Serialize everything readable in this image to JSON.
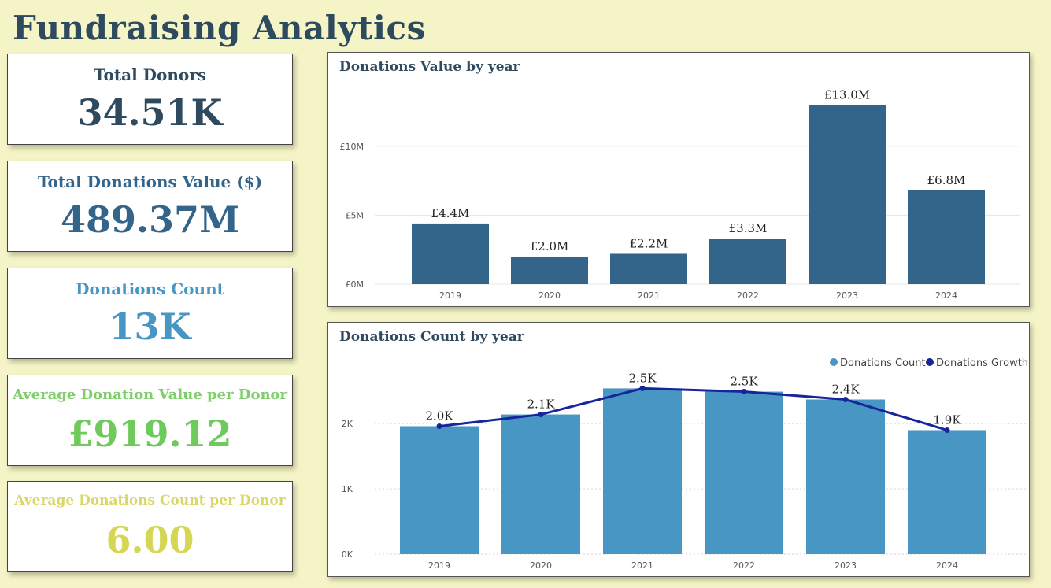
{
  "header": {
    "title": "Fundraising Analytics"
  },
  "kpis": [
    {
      "label": "Total Donors",
      "value": "34.51K",
      "label_color": "#2e4a5e",
      "value_color": "#2e4a5e"
    },
    {
      "label": "Total Donations Value ($)",
      "value": "489.37M",
      "label_color": "#336489",
      "value_color": "#336489"
    },
    {
      "label": "Donations Count",
      "value": "13K",
      "label_color": "#4896c4",
      "value_color": "#4896c4"
    },
    {
      "label": "Average Donation Value per Donor",
      "value": "£919.12",
      "label_color": "#7ecf6a",
      "value_color": "#6fca5c"
    },
    {
      "label": "Average Donations Count per Donor",
      "value": "6.00",
      "label_color": "#d8d86a",
      "value_color": "#d6d655"
    }
  ],
  "chart_data": [
    {
      "type": "bar",
      "title": "Donations Value by year",
      "categories": [
        "2019",
        "2020",
        "2021",
        "2022",
        "2023",
        "2024"
      ],
      "values": [
        4.4,
        2.0,
        2.2,
        3.3,
        13.0,
        6.8
      ],
      "data_labels": [
        "£4.4M",
        "£2.0M",
        "£2.2M",
        "£3.3M",
        "£13.0M",
        "£6.8M"
      ],
      "ytick_values": [
        0,
        5,
        10
      ],
      "ytick_labels": [
        "£0M",
        "£5M",
        "£10M"
      ],
      "ylim": [
        0,
        14.5
      ],
      "bar_color": "#336489",
      "grid": true
    },
    {
      "type": "bar",
      "title": "Donations Count by year",
      "categories": [
        "2019",
        "2020",
        "2021",
        "2022",
        "2023",
        "2024"
      ],
      "series": [
        {
          "name": "Donations Count",
          "type": "bar",
          "values": [
            1960,
            2140,
            2540,
            2490,
            2370,
            1900
          ],
          "color": "#4896c4"
        },
        {
          "name": "Donations Growth",
          "type": "line",
          "values": [
            1960,
            2140,
            2540,
            2490,
            2370,
            1900
          ],
          "color": "#17259a"
        }
      ],
      "data_labels": [
        "2.0K",
        "2.1K",
        "2.5K",
        "2.5K",
        "2.4K",
        "1.9K"
      ],
      "ytick_values": [
        0,
        1000,
        2000
      ],
      "ytick_labels": [
        "0K",
        "1K",
        "2K"
      ],
      "ylim": [
        0,
        2750
      ],
      "legend_position": "top-right",
      "grid": true
    }
  ]
}
